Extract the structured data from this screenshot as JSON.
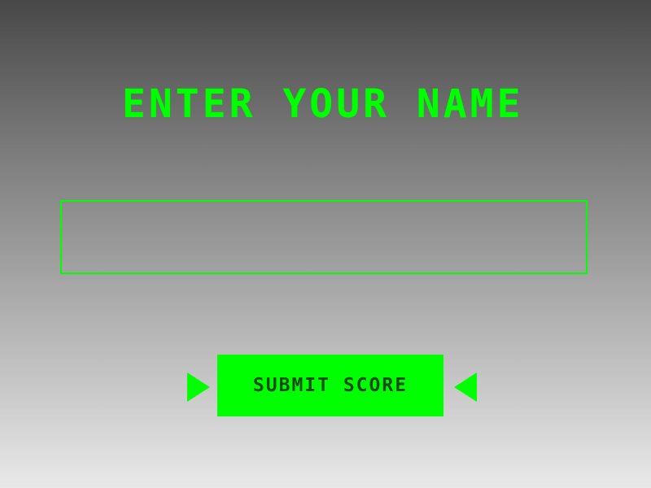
{
  "title": "ENTER YOUR NAME",
  "name_input": {
    "value": "",
    "placeholder": ""
  },
  "submit_button": {
    "label": "SUBMIT SCORE"
  },
  "icons": {
    "left_arrow": "arrow-right-triangle",
    "right_arrow": "arrow-left-triangle"
  },
  "colors": {
    "accent": "#00ff00",
    "button_text": "#0a4a0a",
    "background_top": "#484848",
    "background_bottom": "#e9e9e9"
  }
}
